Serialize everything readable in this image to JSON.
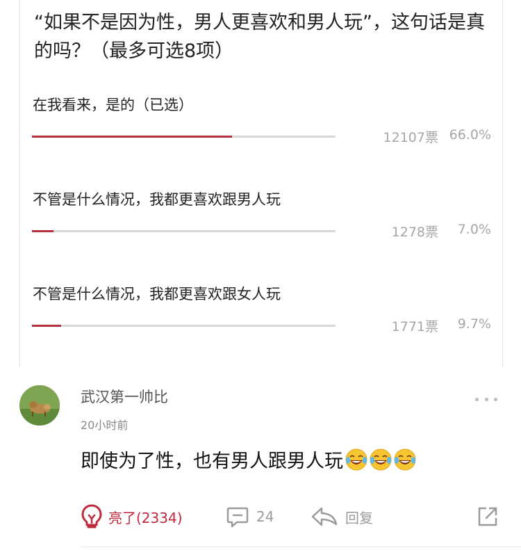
{
  "poll": {
    "question": "“如果不是因为性，男人更喜欢和男人玩”，这句话是真的吗？（最多可选8项）",
    "options": [
      {
        "label": "在我看来，是的（已选）",
        "votes": "12107票",
        "percent": "66.0%",
        "fill": 0.66
      },
      {
        "label": "不管是什么情况，我都更喜欢跟男人玩",
        "votes": "1278票",
        "percent": "7.0%",
        "fill": 0.07
      },
      {
        "label": "不管是什么情况，我都更喜欢跟女人玩",
        "votes": "1771票",
        "percent": "9.7%",
        "fill": 0.097
      }
    ],
    "bar_color": "#b5303e"
  },
  "comment": {
    "username": "武汉第一帅比",
    "timestamp": "20小时前",
    "text": "即使为了性，也有男人跟男人玩",
    "emojis": [
      "laugh-cry-emoji",
      "laugh-cry-emoji",
      "laugh-cry-emoji"
    ],
    "actions": {
      "light_label": "亮了(2334)",
      "reply_count": "24",
      "reply_label": "回复"
    },
    "accent_color": "#c0283b"
  }
}
